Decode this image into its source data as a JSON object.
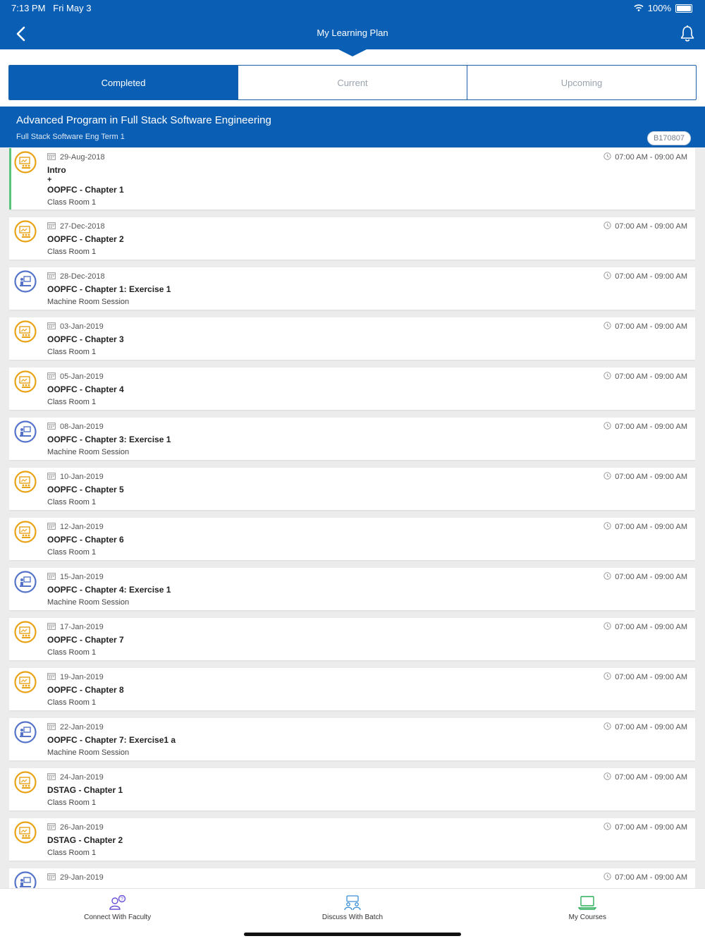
{
  "status_bar": {
    "time": "7:13 PM",
    "date": "Fri May 3",
    "battery": "100%"
  },
  "header": {
    "title": "My Learning Plan"
  },
  "tabs": [
    {
      "label": "Completed",
      "active": true
    },
    {
      "label": "Current",
      "active": false
    },
    {
      "label": "Upcoming",
      "active": false
    }
  ],
  "program": {
    "title": "Advanced Program in Full Stack Software Engineering",
    "term": "Full Stack Software Eng Term 1",
    "batch": "B170807"
  },
  "sessions": [
    {
      "type": "classroom",
      "date": "29-Aug-2018",
      "time": "07:00 AM - 09:00 AM",
      "title": "Intro",
      "title_plus": "+",
      "title2": "OOPFC - Chapter 1",
      "room": "Class Room 1",
      "highlight": true
    },
    {
      "type": "classroom",
      "date": "27-Dec-2018",
      "time": "07:00 AM - 09:00 AM",
      "title": "OOPFC - Chapter 2",
      "room": "Class Room 1"
    },
    {
      "type": "machine",
      "date": "28-Dec-2018",
      "time": "07:00 AM - 09:00 AM",
      "title": "OOPFC - Chapter 1: Exercise 1",
      "room": "Machine Room Session"
    },
    {
      "type": "classroom",
      "date": "03-Jan-2019",
      "time": "07:00 AM - 09:00 AM",
      "title": "OOPFC - Chapter 3",
      "room": "Class Room 1"
    },
    {
      "type": "classroom",
      "date": "05-Jan-2019",
      "time": "07:00 AM - 09:00 AM",
      "title": "OOPFC - Chapter 4",
      "room": "Class Room 1"
    },
    {
      "type": "machine",
      "date": "08-Jan-2019",
      "time": "07:00 AM - 09:00 AM",
      "title": "OOPFC - Chapter 3: Exercise 1",
      "room": "Machine Room Session"
    },
    {
      "type": "classroom",
      "date": "10-Jan-2019",
      "time": "07:00 AM - 09:00 AM",
      "title": "OOPFC - Chapter 5",
      "room": "Class Room 1"
    },
    {
      "type": "classroom",
      "date": "12-Jan-2019",
      "time": "07:00 AM - 09:00 AM",
      "title": "OOPFC - Chapter 6",
      "room": "Class Room 1"
    },
    {
      "type": "machine",
      "date": "15-Jan-2019",
      "time": "07:00 AM - 09:00 AM",
      "title": "OOPFC - Chapter 4: Exercise 1",
      "room": "Machine Room Session"
    },
    {
      "type": "classroom",
      "date": "17-Jan-2019",
      "time": "07:00 AM - 09:00 AM",
      "title": "OOPFC - Chapter 7",
      "room": "Class Room 1"
    },
    {
      "type": "classroom",
      "date": "19-Jan-2019",
      "time": "07:00 AM - 09:00 AM",
      "title": "OOPFC - Chapter 8",
      "room": "Class Room 1"
    },
    {
      "type": "machine",
      "date": "22-Jan-2019",
      "time": "07:00 AM - 09:00 AM",
      "title": "OOPFC - Chapter 7: Exercise1 a",
      "room": "Machine Room Session"
    },
    {
      "type": "classroom",
      "date": "24-Jan-2019",
      "time": "07:00 AM - 09:00 AM",
      "title": "DSTAG - Chapter 1",
      "room": "Class Room 1"
    },
    {
      "type": "classroom",
      "date": "26-Jan-2019",
      "time": "07:00 AM - 09:00 AM",
      "title": "DSTAG - Chapter 2",
      "room": "Class Room 1"
    },
    {
      "type": "machine",
      "date": "29-Jan-2019",
      "time": "07:00 AM - 09:00 AM",
      "title": "",
      "room": ""
    }
  ],
  "footer": [
    {
      "label": "Connect With Faculty",
      "icon": "faculty-icon",
      "color": "#6a4fd8"
    },
    {
      "label": "Discuss With Batch",
      "icon": "batch-icon",
      "color": "#3a8fd6"
    },
    {
      "label": "My Courses",
      "icon": "laptop-icon",
      "color": "#2fae5c"
    }
  ],
  "colors": {
    "primary": "#0a5fb4",
    "classroom_icon": "#e8a317",
    "machine_icon": "#5574c9",
    "highlight": "#57c47a"
  }
}
